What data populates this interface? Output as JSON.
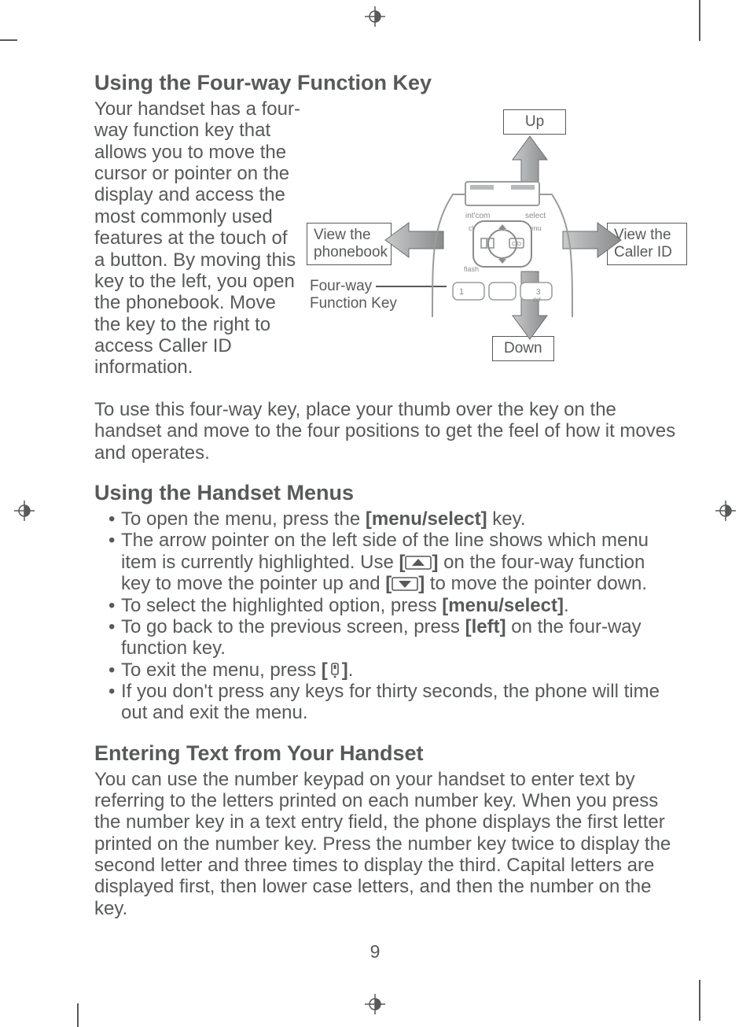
{
  "headings": {
    "h1": "Using the Four-way Function Key",
    "h2": "Using the Handset Menus",
    "h3": "Entering Text from Your Handset"
  },
  "intro": "Your handset has a four-way function key that allows you to move the cursor or pointer on the display and access the most commonly used features at the touch of a button. By moving this key to the left, you open the phonebook. Move the key to the right to access Caller ID information.",
  "diagram": {
    "up": "Up",
    "down": "Down",
    "left": "View the\nphonebook",
    "right": "View the\nCaller ID",
    "center_label": "Four-way\nFunction Key",
    "device_labels": {
      "intcom": "int'com",
      "select": "select",
      "clear": "clear",
      "menu": "menu",
      "flash": "flash",
      "cid": "CID",
      "def": "def"
    }
  },
  "para2": "To use this four-way key, place your thumb over the key on the handset and move to the four positions to get the feel of how it moves and operates.",
  "menu_items": {
    "i1a": "To open the menu, press the ",
    "i1b": "[menu/select]",
    "i1c": " key.",
    "i2a": "The arrow pointer on the left side of the line shows which menu item is currently highlighted. Use ",
    "i2b": " on the four-way function key to move the pointer up and ",
    "i2c": " to move the pointer down.",
    "i3a": "To select the highlighted option, press ",
    "i3b": "[menu/select]",
    "i3c": ".",
    "i4a": "To go back to the previous screen, press ",
    "i4b": "[left]",
    "i4c": " on the four-way function key.",
    "i5a": "To exit the menu, press ",
    "i5c": ".",
    "i6": "If you don't press any keys for thirty seconds, the phone will time out and exit the menu."
  },
  "entering_text": "You can use the number keypad on your handset to enter text by referring to the letters printed on each number key. When you press the number key in a text entry field, the phone displays the first letter printed on the number key. Press the number key twice to display the second letter and three times to display the third. Capital letters are displayed first, then lower case letters, and then the number on the key.",
  "page_number": "9",
  "inline_keys": {
    "up_bracket_open": "[",
    "up_bracket_close": "]",
    "down_bracket_open": "[",
    "down_bracket_close": "]",
    "end_bracket_open": "[",
    "end_bracket_close": "]"
  }
}
